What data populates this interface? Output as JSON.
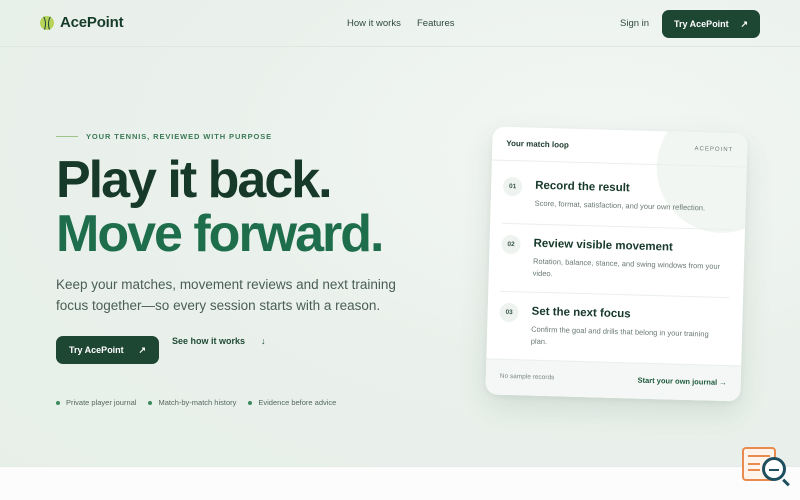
{
  "nav": {
    "brand": "AcePoint",
    "links": [
      "How it works",
      "Features"
    ],
    "sign_in": "Sign in",
    "cta": "Try AcePoint",
    "cta_arrow": "↗"
  },
  "hero": {
    "eyebrow": "YOUR TENNIS, REVIEWED WITH PURPOSE",
    "headline_1": "Play it back.",
    "headline_2": "Move forward.",
    "lead": "Keep your matches, movement reviews and next training focus together—so every session starts with a reason.",
    "primary_cta": "Try AcePoint",
    "primary_arrow": "↗",
    "secondary_cta": "See how it works",
    "secondary_arrow": "↓",
    "features": [
      "Private player journal",
      "Match-by-match history",
      "Evidence before advice"
    ]
  },
  "card": {
    "title": "Your match loop",
    "tag": "ACEPOINT",
    "steps": [
      {
        "num": "01",
        "title": "Record the result",
        "desc": "Score, format, satisfaction, and your own reflection."
      },
      {
        "num": "02",
        "title": "Review visible movement",
        "desc": "Rotation, balance, stance, and swing windows from your video."
      },
      {
        "num": "03",
        "title": "Set the next focus",
        "desc": "Confirm the goal and drills that belong in your training plan."
      }
    ],
    "footer_left": "No sample records",
    "footer_right": "Start your own journal →"
  },
  "colors": {
    "brand_dark": "#1d4633",
    "brand_green": "#1e6e4c",
    "accent_lime": "#b8d35a"
  }
}
